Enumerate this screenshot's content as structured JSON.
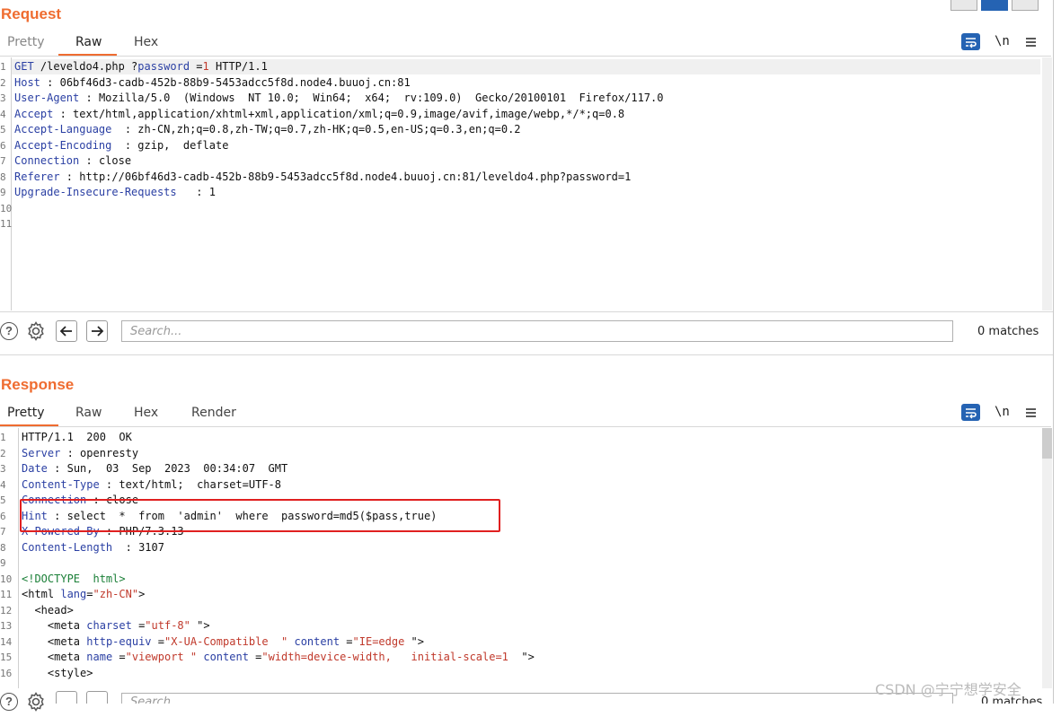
{
  "request": {
    "title": "Request",
    "tabs": [
      "Pretty",
      "Raw",
      "Hex"
    ],
    "active_tab": "Raw",
    "icons": {
      "wrap": "word-wrap-icon",
      "newline": "\\n",
      "menu": "menu-icon"
    },
    "lines": [
      {
        "n": "1",
        "k": "GET",
        "rest": " /leveldo4.php ?",
        "p": "password",
        "eq": " =",
        "val": "1",
        "tail": " HTTP/1.1"
      },
      {
        "n": "2",
        "k": "Host",
        "sep": " : ",
        "v": "06bf46d3-cadb-452b-88b9-5453adcc5f8d.node4.buuoj.cn:81"
      },
      {
        "n": "3",
        "k": "User-Agent",
        "sep": " : ",
        "v": "Mozilla/5.0  (Windows  NT 10.0;  Win64;  x64;  rv:109.0)  Gecko/20100101  Firefox/117.0"
      },
      {
        "n": "4",
        "k": "Accept",
        "sep": " : ",
        "v": "text/html,application/xhtml+xml,application/xml;q=0.9,image/avif,image/webp,*/*;q=0.8"
      },
      {
        "n": "5",
        "k": "Accept-Language",
        "sep": "  : ",
        "v": "zh-CN,zh;q=0.8,zh-TW;q=0.7,zh-HK;q=0.5,en-US;q=0.3,en;q=0.2"
      },
      {
        "n": "6",
        "k": "Accept-Encoding",
        "sep": "  : ",
        "v": "gzip,  deflate"
      },
      {
        "n": "7",
        "k": "Connection",
        "sep": " : ",
        "v": "close"
      },
      {
        "n": "8",
        "k": "Referer",
        "sep": " : ",
        "v": "http://06bf46d3-cadb-452b-88b9-5453adcc5f8d.node4.buuoj.cn:81/leveldo4.php?password=1"
      },
      {
        "n": "9",
        "k": "Upgrade-Insecure-Requests",
        "sep": "   : ",
        "v": "1"
      },
      {
        "n": "10"
      },
      {
        "n": "11"
      }
    ],
    "search_placeholder": "Search...",
    "matches": "0 matches"
  },
  "response": {
    "title": "Response",
    "tabs": [
      "Pretty",
      "Raw",
      "Hex",
      "Render"
    ],
    "active_tab": "Pretty",
    "header_lines": [
      {
        "n": "1",
        "plain": "HTTP/1.1  200  OK"
      },
      {
        "n": "2",
        "k": "Server",
        "sep": " : ",
        "v": "openresty"
      },
      {
        "n": "3",
        "k": "Date",
        "sep": " : ",
        "v": "Sun,  03  Sep  2023  00:34:07  GMT"
      },
      {
        "n": "4",
        "k": "Content-Type",
        "sep": " : ",
        "v": "text/html;  charset=UTF-8"
      },
      {
        "n": "5",
        "k": "Connection",
        "sep": " : ",
        "v": "close"
      },
      {
        "n": "6",
        "k": "Hint",
        "sep": " : ",
        "v": "select  *  from  'admin'  where  password=md5($pass,true)"
      },
      {
        "n": "7",
        "k": "X-Powered-By",
        "sep": " : ",
        "v": "PHP/7.3.13"
      },
      {
        "n": "8",
        "k": "Content-Length",
        "sep": "  : ",
        "v": "3107"
      },
      {
        "n": "9"
      }
    ],
    "html_lines": [
      {
        "n": "10",
        "text": "<!DOCTYPE  html>"
      },
      {
        "n": "11",
        "open": "<html",
        "attr": "lang",
        "eq": "=",
        "str": "\"zh-CN\"",
        "close": ">"
      },
      {
        "n": "12",
        "indent": "  ",
        "text": "<head>"
      },
      {
        "n": "13",
        "indent": "    ",
        "open": "<meta",
        "attr": "charset",
        "eq": " =",
        "str": "\"utf-8\"",
        "close": " \">"
      },
      {
        "n": "14",
        "indent": "    ",
        "open": "<meta",
        "attr": "http-equiv",
        "eq": " =",
        "str": "\"X-UA-Compatible  \"",
        "attr2": "content",
        "eq2": " =",
        "str2": "\"IE=edge",
        "close": " \">"
      },
      {
        "n": "15",
        "indent": "    ",
        "open": "<meta",
        "attr": "name",
        "eq": " =",
        "str": "\"viewport \"",
        "attr2": "content",
        "eq2": " =",
        "str2": "\"width=device-width,   initial-scale=1 ",
        "close": " \">"
      },
      {
        "n": "16",
        "indent": "    ",
        "text": "<style>"
      }
    ],
    "search_placeholder": "Search...",
    "matches": "0 matches"
  },
  "watermark": "CSDN @宁宁想学安全",
  "colors": {
    "accent": "#ef6c30",
    "key": "#2a3fa3",
    "string": "#c0392b",
    "highlight_box": "#e02020"
  }
}
